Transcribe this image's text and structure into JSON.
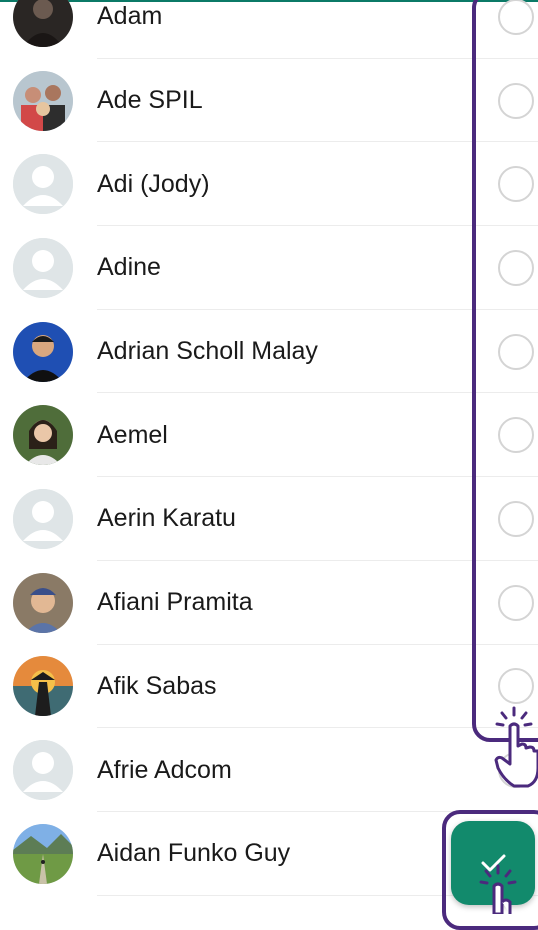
{
  "contacts": [
    {
      "name": "Adam",
      "avatar": "photo-dark"
    },
    {
      "name": "Ade SPIL",
      "avatar": "photo-family"
    },
    {
      "name": "Adi (Jody)",
      "avatar": "default"
    },
    {
      "name": "Adine",
      "avatar": "default"
    },
    {
      "name": "Adrian Scholl Malay",
      "avatar": "photo-man"
    },
    {
      "name": "Aemel",
      "avatar": "photo-woman"
    },
    {
      "name": "Aerin Karatu",
      "avatar": "default"
    },
    {
      "name": "Afiani Pramita",
      "avatar": "photo-child"
    },
    {
      "name": "Afik Sabas",
      "avatar": "photo-sunset"
    },
    {
      "name": "Afrie Adcom",
      "avatar": "default"
    },
    {
      "name": "Aidan Funko Guy",
      "avatar": "photo-landscape"
    }
  ],
  "fab": {
    "icon": "checkmark-icon"
  },
  "colors": {
    "accent": "#128a6c",
    "highlight": "#4b2a7d",
    "divider": "#ececec",
    "radio_border": "#d4d4d4"
  }
}
